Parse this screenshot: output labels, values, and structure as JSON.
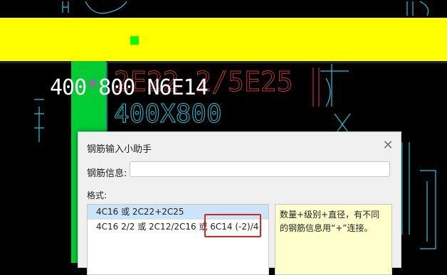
{
  "cad_canvas": {
    "annotation_text": "400*800 N6E14",
    "annotation_star": "*",
    "annotation_prefix": "400",
    "annotation_suffix": "800 N6E14",
    "label_400x800": "400X800",
    "red_text": "2E22 2/5E25",
    "colors": {
      "background": "#000000",
      "band": "#ffff00",
      "column": "#00cc33",
      "cyan_lines": "#22c8d8",
      "red_lines": "#c83232"
    }
  },
  "dialog": {
    "title": "钢筋输入小助手",
    "close_icon": "close-icon",
    "rebar_info_label": "钢筋信息:",
    "rebar_info_value": "",
    "format_label": "格式:",
    "format_items": [
      {
        "text": "4C16 或 2C22+2C25",
        "selected": true
      },
      {
        "text": "4C16 2/2 或 2C12/2C16 或 6C14 (-2)/4",
        "selected": false
      }
    ],
    "hint": "数量+级别+直径，有不同的钢筋信息用“+”连接。"
  }
}
